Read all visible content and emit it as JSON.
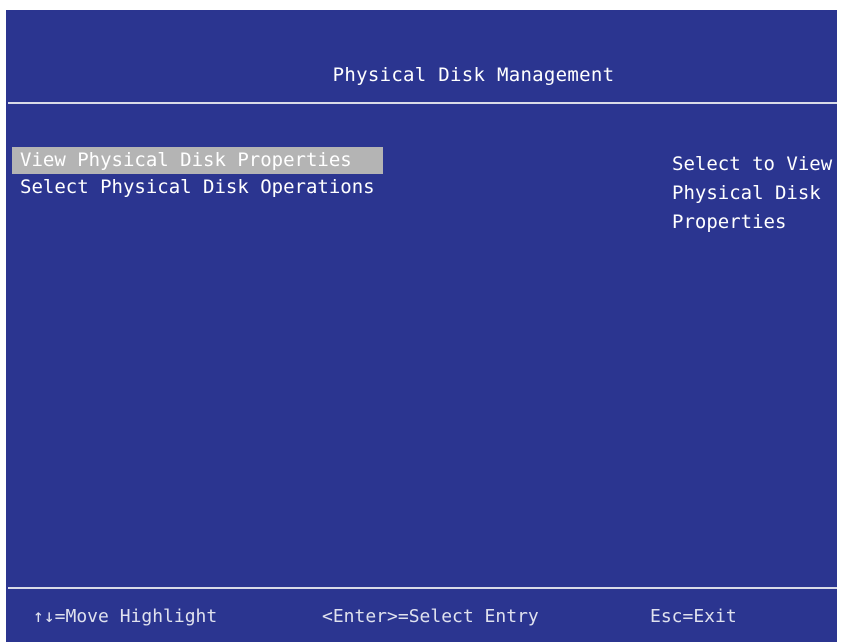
{
  "title": "Physical Disk Management",
  "menu": {
    "items": [
      {
        "label": "View Physical Disk Properties",
        "selected": true
      },
      {
        "label": "Select Physical Disk Operations",
        "selected": false
      }
    ]
  },
  "help": {
    "lines": [
      "Select to View",
      "Physical Disk",
      "Properties"
    ]
  },
  "footer": {
    "move": "↑↓=Move Highlight",
    "enter": "<Enter>=Select Entry",
    "esc": "Esc=Exit"
  },
  "colors": {
    "background": "#2b3590",
    "highlight": "#b4b4b4",
    "text": "#ffffff"
  }
}
